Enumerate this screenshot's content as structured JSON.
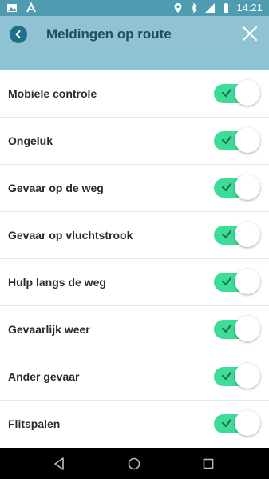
{
  "status_bar": {
    "time": "14:21",
    "left_icons": [
      "image-icon",
      "app-logo-icon"
    ],
    "right_icons": [
      "location-icon",
      "bluetooth-icon",
      "signal-icon",
      "battery-icon"
    ]
  },
  "header": {
    "title": "Meldingen op route",
    "back_icon": "chevron-left-icon",
    "close_icon": "close-icon"
  },
  "settings": {
    "items": [
      {
        "label": "Mobiele controle",
        "enabled": true
      },
      {
        "label": "Ongeluk",
        "enabled": true
      },
      {
        "label": "Gevaar op de weg",
        "enabled": true
      },
      {
        "label": "Gevaar op vluchtstrook",
        "enabled": true
      },
      {
        "label": "Hulp langs de weg",
        "enabled": true
      },
      {
        "label": "Gevaarlijk weer",
        "enabled": true
      },
      {
        "label": "Ander gevaar",
        "enabled": true
      },
      {
        "label": "Flitspalen",
        "enabled": true
      }
    ]
  },
  "nav": {
    "back": "back-icon",
    "home": "home-icon",
    "recents": "recents-icon"
  },
  "colors": {
    "status_bar": "#4f9cb1",
    "app_bar": "#8fc2d2",
    "toggle_on": "#3ddc97",
    "title": "#1f4f61"
  }
}
